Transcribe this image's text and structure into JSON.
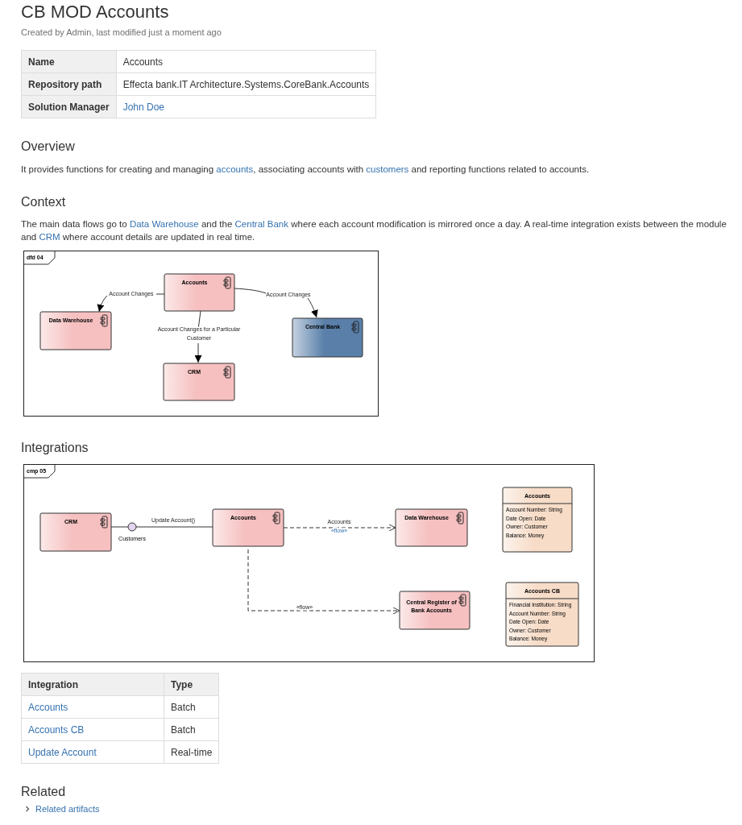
{
  "title": "CB MOD Accounts",
  "byline": "Created by Admin, last modified just a moment ago",
  "properties": [
    {
      "label": "Name",
      "value": "Accounts",
      "link": false
    },
    {
      "label": "Repository path",
      "value": "Effecta bank.IT Architecture.Systems.CoreBank.Accounts",
      "link": false
    },
    {
      "label": "Solution Manager",
      "value": "John Doe",
      "link": true
    }
  ],
  "overview": {
    "heading": "Overview",
    "paragraph": [
      {
        "kind": "text",
        "text": "It provides functions for creating and managing "
      },
      {
        "kind": "link",
        "text": "accounts"
      },
      {
        "kind": "text",
        "text": ", associating accounts with "
      },
      {
        "kind": "link",
        "text": "customers"
      },
      {
        "kind": "text",
        "text": " and reporting functions related to accounts."
      }
    ]
  },
  "context": {
    "heading": "Context",
    "paragraph": [
      {
        "kind": "text",
        "text": "The main data flows go to "
      },
      {
        "kind": "link",
        "text": "Data Warehouse"
      },
      {
        "kind": "text",
        "text": " and the "
      },
      {
        "kind": "link",
        "text": "Central Bank"
      },
      {
        "kind": "text",
        "text": " where each account modification is mirrored once a day. A real-time integration exists between the module and "
      },
      {
        "kind": "link",
        "text": "CRM"
      },
      {
        "kind": "text",
        "text": " where account details are updated in real time."
      }
    ],
    "diagram": {
      "frame": "dfd 04",
      "nodes": [
        {
          "kind": "component",
          "lines": [
            "Accounts"
          ],
          "color": "#f6c0c0"
        },
        {
          "kind": "component",
          "lines": [
            "Data Warehouse"
          ],
          "color": "#f6c0c0"
        },
        {
          "kind": "component",
          "lines": [
            "Central Bank"
          ],
          "color": "#5a80aa"
        },
        {
          "kind": "component",
          "lines": [
            "CRM"
          ],
          "color": "#f6c0c0"
        }
      ],
      "edges": [
        {
          "kind": "arrow",
          "lines": [
            "Account Changes"
          ]
        },
        {
          "kind": "arrow",
          "lines": [
            "Account Changes"
          ]
        },
        {
          "kind": "arrow",
          "lines": [
            "Account Changes for a Particular",
            "Customer"
          ]
        }
      ]
    }
  },
  "integrations": {
    "heading": "Integrations",
    "diagram": {
      "frame": "cmp 05",
      "nodes": [
        {
          "kind": "component",
          "lines": [
            "CRM"
          ],
          "color": "#f6c0c0"
        },
        {
          "kind": "interface",
          "lines": [
            "Customers"
          ],
          "color": "#e3d5f0"
        },
        {
          "kind": "component",
          "lines": [
            "Accounts"
          ],
          "color": "#f6c0c0"
        },
        {
          "kind": "component",
          "lines": [
            "Data Warehouse"
          ],
          "color": "#f6c0c0"
        },
        {
          "kind": "component",
          "lines": [
            "Central Register of",
            "Bank Accounts"
          ],
          "color": "#f6c0c0"
        },
        {
          "kind": "class",
          "lines": [
            "Accounts"
          ],
          "attributes": [
            "Account Number: String",
            "Date Open: Date",
            "Owner: Customer",
            "Balance: Money"
          ],
          "color": "#f7dcc8"
        },
        {
          "kind": "class",
          "lines": [
            "Accounts CB"
          ],
          "attributes": [
            "Financial Institution: String",
            "Account Number: String",
            "Date Open: Date",
            "Owner: Customer",
            "Balance: Money"
          ],
          "color": "#f7dcc8"
        }
      ],
      "edges": [
        {
          "kind": "line",
          "lines": [
            "Update Account()"
          ]
        },
        {
          "kind": "flow",
          "lines": [
            "Accounts",
            "«flow»"
          ]
        },
        {
          "kind": "flow",
          "lines": [
            "«flow»"
          ]
        }
      ]
    },
    "table": {
      "columns": [
        "Integration",
        "Type"
      ],
      "rows": [
        [
          "Accounts",
          "Batch"
        ],
        [
          "Accounts CB",
          "Batch"
        ],
        [
          "Update Account",
          "Real-time"
        ]
      ]
    }
  },
  "related": {
    "heading": "Related",
    "link": "Related artifacts",
    "expanded": false
  }
}
